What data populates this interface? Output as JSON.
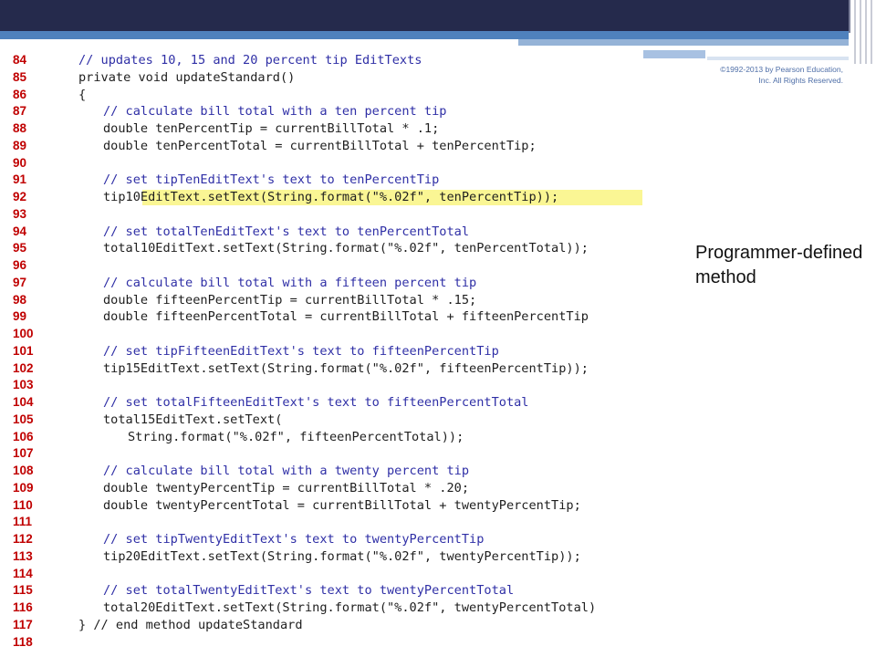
{
  "colors": {
    "header_bar": "#252a4c",
    "accent_blue": "#4f81bd",
    "line_number": "#c00000",
    "comment": "#2f2fa6",
    "highlight": "#f5ee3c"
  },
  "copyright": "©1992-2013 by Pearson Education, Inc. All Rights Reserved.",
  "callout": "Programmer-defined method",
  "code_lines": [
    {
      "num": "84",
      "text": "// updates 10, 15 and 20 percent tip EditTexts",
      "indent": 0,
      "comment": true
    },
    {
      "num": "85",
      "text": "private void updateStandard()",
      "indent": 0
    },
    {
      "num": "86",
      "text": "{",
      "indent": 0
    },
    {
      "num": "87",
      "text": "// calculate bill total with a ten percent tip",
      "indent": 1,
      "comment": true
    },
    {
      "num": "88",
      "text": "double tenPercentTip = currentBillTotal * .1;",
      "indent": 1
    },
    {
      "num": "89",
      "text": "double tenPercentTotal = currentBillTotal + tenPercentTip;",
      "indent": 1
    },
    {
      "num": "90",
      "text": "",
      "indent": 0
    },
    {
      "num": "91",
      "text": "// set tipTenEditText's text to tenPercentTip",
      "indent": 1,
      "comment": true
    },
    {
      "num": "92",
      "text": "tip10EditText.setText(String.format(\"%.02f\", tenPercentTip));",
      "indent": 1,
      "highlight": true
    },
    {
      "num": "93",
      "text": "",
      "indent": 0
    },
    {
      "num": "94",
      "text": "// set totalTenEditText's text to tenPercentTotal",
      "indent": 1,
      "comment": true
    },
    {
      "num": "95",
      "text": "total10EditText.setText(String.format(\"%.02f\", tenPercentTotal));",
      "indent": 1
    },
    {
      "num": "96",
      "text": "",
      "indent": 0
    },
    {
      "num": "97",
      "text": "// calculate bill total with a fifteen percent tip",
      "indent": 1,
      "comment": true
    },
    {
      "num": "98",
      "text": "double fifteenPercentTip = currentBillTotal * .15;",
      "indent": 1
    },
    {
      "num": "99",
      "text": "double fifteenPercentTotal = currentBillTotal + fifteenPercentTip",
      "indent": 1
    },
    {
      "num": "100",
      "text": "",
      "indent": 0
    },
    {
      "num": "101",
      "text": "// set tipFifteenEditText's text to fifteenPercentTip",
      "indent": 1,
      "comment": true
    },
    {
      "num": "102",
      "text": "tip15EditText.setText(String.format(\"%.02f\", fifteenPercentTip));",
      "indent": 1
    },
    {
      "num": "103",
      "text": "",
      "indent": 0
    },
    {
      "num": "104",
      "text": "// set totalFifteenEditText's text to fifteenPercentTotal",
      "indent": 1,
      "comment": true
    },
    {
      "num": "105",
      "text": "total15EditText.setText(",
      "indent": 1
    },
    {
      "num": "106",
      "text": "String.format(\"%.02f\", fifteenPercentTotal));",
      "indent": 2
    },
    {
      "num": "107",
      "text": "",
      "indent": 0
    },
    {
      "num": "108",
      "text": "// calculate bill total with a twenty percent tip",
      "indent": 1,
      "comment": true
    },
    {
      "num": "109",
      "text": "double twentyPercentTip = currentBillTotal * .20;",
      "indent": 1
    },
    {
      "num": "110",
      "text": "double twentyPercentTotal = currentBillTotal + twentyPercentTip;",
      "indent": 1
    },
    {
      "num": "111",
      "text": "",
      "indent": 0
    },
    {
      "num": "112",
      "text": "// set tipTwentyEditText's text to twentyPercentTip",
      "indent": 1,
      "comment": true
    },
    {
      "num": "113",
      "text": "tip20EditText.setText(String.format(\"%.02f\", twentyPercentTip));",
      "indent": 1
    },
    {
      "num": "114",
      "text": "",
      "indent": 0
    },
    {
      "num": "115",
      "text": "// set totalTwentyEditText's text to twentyPercentTotal",
      "indent": 1,
      "comment": true
    },
    {
      "num": "116",
      "text": "total20EditText.setText(String.format(\"%.02f\", twentyPercentTotal)",
      "indent": 1
    },
    {
      "num": "117",
      "text": "} // end method updateStandard",
      "indent": 0
    },
    {
      "num": "118",
      "text": "",
      "indent": 0
    }
  ]
}
